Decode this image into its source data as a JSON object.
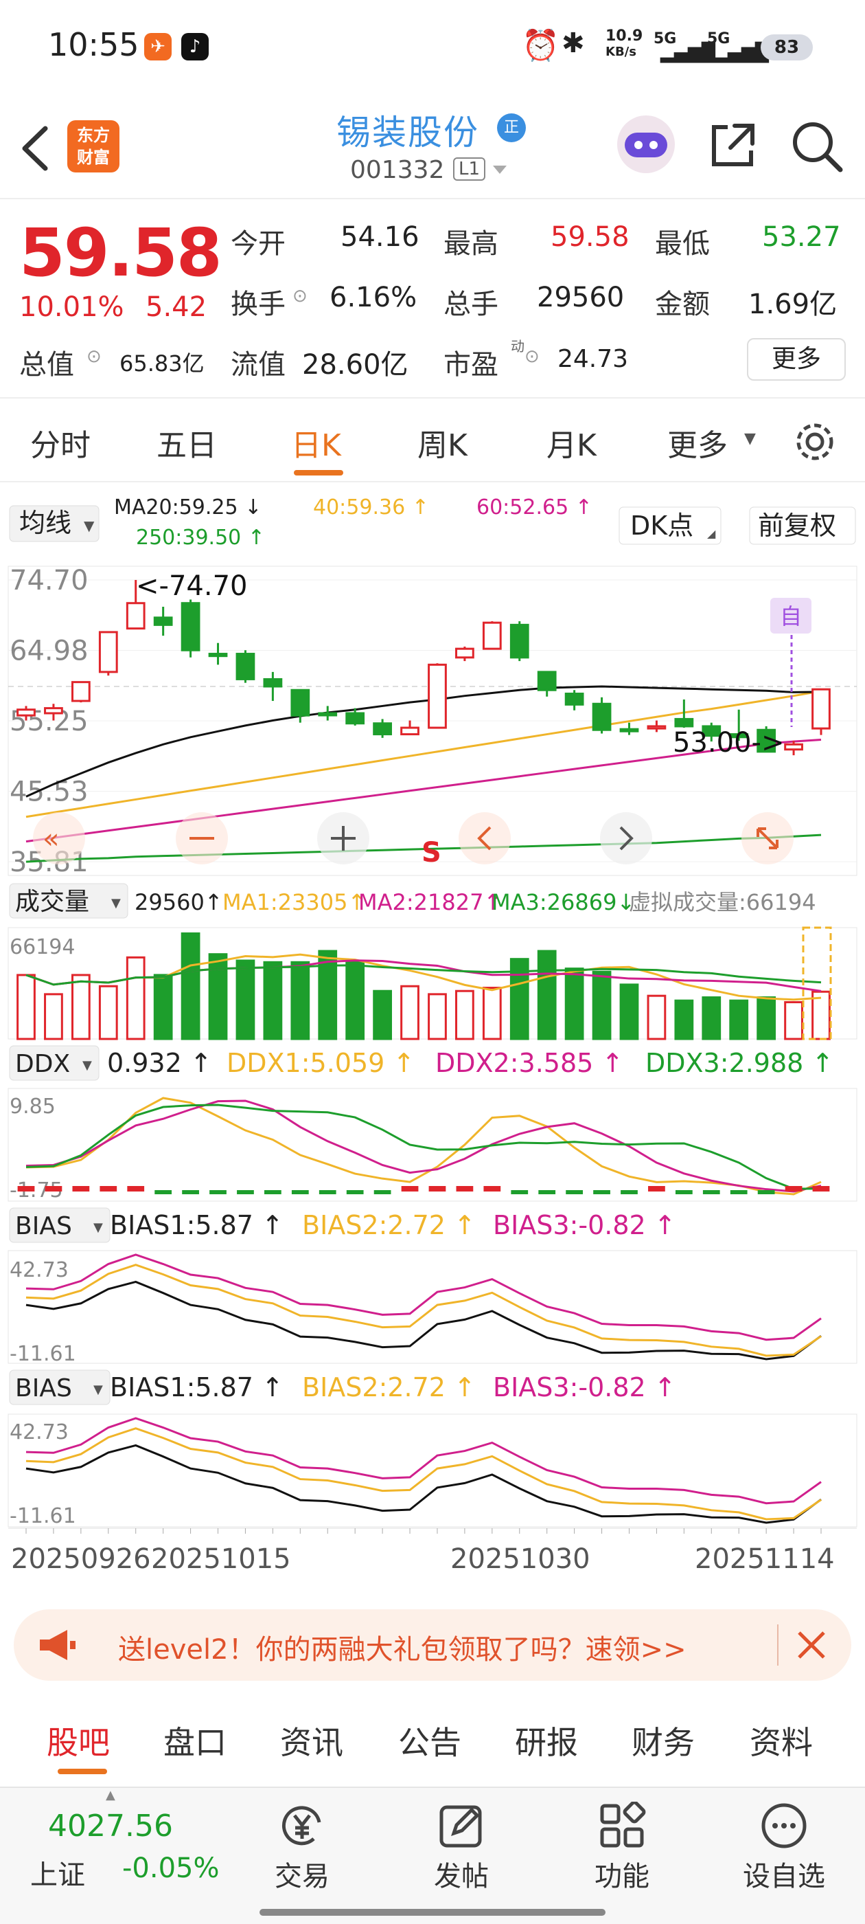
{
  "status_bar": {
    "time": "10:55",
    "net_speed": "10.9",
    "net_unit": "KB/s",
    "signal1": "5G",
    "signal2": "5G",
    "battery": "83"
  },
  "header": {
    "logo_line1": "东方",
    "logo_line2": "财富",
    "stock_name": "锡装股份",
    "badge": "正",
    "code": "001332",
    "level": "L1"
  },
  "quote": {
    "price": "59.58",
    "change_pct": "10.01%",
    "change": "5.42",
    "open_label": "今开",
    "open": "54.16",
    "high_label": "最高",
    "high": "59.58",
    "low_label": "最低",
    "low": "53.27",
    "turnover_label": "换手",
    "turnover": "6.16%",
    "volume_label": "总手",
    "volume": "29560",
    "amount_label": "金额",
    "amount": "1.69亿",
    "mktcap_label": "总值",
    "mktcap": "65.83亿",
    "float_label": "流值",
    "float": "28.60亿",
    "pe_label": "市盈",
    "pe_sup": "动",
    "pe": "24.73",
    "more": "更多"
  },
  "tabs": [
    "分时",
    "五日",
    "日K",
    "周K",
    "月K",
    "更多"
  ],
  "active_tab": "日K",
  "ma_bar": {
    "selector": "均线",
    "ma20": "MA20:59.25 ↓",
    "ma40": "40:59.36 ↑",
    "ma60": "60:52.65 ↑",
    "ma250": "250:39.50 ↑",
    "dk": "DK点",
    "fq": "前复权"
  },
  "kline": {
    "y_ticks": [
      "74.70",
      "64.98",
      "55.25",
      "45.53",
      "35.81"
    ],
    "high_marker": "<-74.70",
    "low_marker": "53.00->",
    "s_marker": "S",
    "zi_marker": "自",
    "colors": {
      "up": "#e0252b",
      "down": "#1d9e2c",
      "ma20": "#111111",
      "ma40": "#f0b429",
      "ma60": "#d01f8c",
      "ma250": "#1d9e2c"
    }
  },
  "volume_bar": {
    "selector": "成交量",
    "vol": "29560↑",
    "ma1": "MA1:23305↑",
    "ma2": "MA2:21827↑",
    "ma3": "MA3:26869↓",
    "virtual": "虚拟成交量:66194",
    "y_top": "66194"
  },
  "ddx_bar": {
    "selector": "DDX",
    "val": "0.932 ↑",
    "ddx1": "DDX1:5.059 ↑",
    "ddx2": "DDX2:3.585 ↑",
    "ddx3": "DDX3:2.988 ↑",
    "y_top": "9.85",
    "y_bottom": "-1.75"
  },
  "bias_bar": {
    "selector": "BIAS",
    "bias1": "BIAS1:5.87 ↑",
    "bias2": "BIAS2:2.72 ↑",
    "bias3": "BIAS3:-0.82 ↑",
    "y_top": "42.73",
    "y_bottom": "-11.61"
  },
  "dates": [
    "20250926",
    "20251015",
    "20251030",
    "20251114"
  ],
  "chart_data": {
    "type": "candlestick",
    "ohlc": [
      [
        56.0,
        57.3,
        56.8,
        55.3
      ],
      [
        56.3,
        57.6,
        57.0,
        55.3
      ],
      [
        58.0,
        60.6,
        60.6,
        57.8
      ],
      [
        62.0,
        67.5,
        67.5,
        61.5
      ],
      [
        68.0,
        74.7,
        71.5,
        68.0
      ],
      [
        69.5,
        71.0,
        68.5,
        67.0
      ],
      [
        71.5,
        72.0,
        65.0,
        64.0
      ],
      [
        64.5,
        66.0,
        64.2,
        63.0
      ],
      [
        64.5,
        65.0,
        61.0,
        60.5
      ],
      [
        61.0,
        62.0,
        60.0,
        58.0
      ],
      [
        59.5,
        59.5,
        56.0,
        55.0
      ],
      [
        56.3,
        57.3,
        56.1,
        55.3
      ],
      [
        56.3,
        57.0,
        54.9,
        54.6
      ],
      [
        54.9,
        55.5,
        53.4,
        52.9
      ],
      [
        53.4,
        55.3,
        54.3,
        53.3
      ],
      [
        54.3,
        63.2,
        63.0,
        54.3
      ],
      [
        64.0,
        65.5,
        65.2,
        63.5
      ],
      [
        65.2,
        69.0,
        68.8,
        65.2
      ],
      [
        68.5,
        69.0,
        64.0,
        63.5
      ],
      [
        62.0,
        62.0,
        59.5,
        58.6
      ],
      [
        59.0,
        59.5,
        57.5,
        56.7
      ],
      [
        57.6,
        58.5,
        54.0,
        53.5
      ],
      [
        54.1,
        55.0,
        54.0,
        53.3
      ],
      [
        54.2,
        55.3,
        54.5,
        53.7
      ],
      [
        55.5,
        58.2,
        54.5,
        54.3
      ],
      [
        54.5,
        55.0,
        53.2,
        52.4
      ],
      [
        53.4,
        56.8,
        53.0,
        52.5
      ],
      [
        54.0,
        54.5,
        51.0,
        51.0
      ],
      [
        51.3,
        52.5,
        52.0,
        50.5
      ],
      [
        54.2,
        59.6,
        59.6,
        53.3
      ]
    ],
    "ma20": [
      44.8,
      46.5,
      48.0,
      49.5,
      50.8,
      52.0,
      53.0,
      53.8,
      54.6,
      55.3,
      55.9,
      56.4,
      56.8,
      57.3,
      57.8,
      58.2,
      58.7,
      59.1,
      59.5,
      59.8,
      59.9,
      60.0,
      59.9,
      59.8,
      59.7,
      59.6,
      59.5,
      59.4,
      59.2,
      59.25
    ],
    "ma40": [
      42.0,
      42.6,
      43.2,
      43.8,
      44.4,
      45.0,
      45.6,
      46.2,
      46.8,
      47.4,
      48.0,
      48.6,
      49.2,
      49.8,
      50.4,
      51.0,
      51.6,
      52.2,
      52.8,
      53.4,
      54.0,
      54.6,
      55.2,
      55.8,
      56.4,
      56.9,
      57.5,
      58.1,
      58.7,
      59.36
    ],
    "ma60": [
      38.6,
      39.1,
      39.6,
      40.1,
      40.6,
      41.1,
      41.6,
      42.1,
      42.6,
      43.1,
      43.6,
      44.1,
      44.6,
      45.1,
      45.6,
      46.1,
      46.6,
      47.1,
      47.6,
      48.1,
      48.6,
      49.1,
      49.6,
      50.1,
      50.6,
      51.1,
      51.6,
      52.1,
      52.4,
      52.65
    ],
    "ma250": [
      35.8,
      36.0,
      36.2,
      36.3,
      36.5,
      36.6,
      36.7,
      36.8,
      36.9,
      37.0,
      37.1,
      37.2,
      37.3,
      37.4,
      37.5,
      37.6,
      37.7,
      37.8,
      37.9,
      38.0,
      38.1,
      38.2,
      38.3,
      38.4,
      38.6,
      38.8,
      39.0,
      39.1,
      39.3,
      39.5
    ],
    "volume": [
      40000,
      28000,
      40000,
      33000,
      51000,
      40000,
      66000,
      53000,
      49000,
      48000,
      48000,
      55000,
      48000,
      30000,
      33000,
      28000,
      30000,
      32000,
      50000,
      55000,
      44000,
      42000,
      34000,
      27000,
      24000,
      26000,
      24000,
      26000,
      23000,
      29560
    ],
    "ylim": [
      35.81,
      74.7
    ]
  },
  "banner": {
    "text": "送level2！你的两融大礼包领取了吗？速领>>"
  },
  "sub_tabs": [
    "股吧",
    "盘口",
    "资讯",
    "公告",
    "研报",
    "财务",
    "资料"
  ],
  "bottom_nav": {
    "index_value": "4027.56",
    "index_name": "上证",
    "index_change": "-0.05%",
    "trade": "交易",
    "post": "发帖",
    "functions": "功能",
    "watch": "设自选"
  }
}
